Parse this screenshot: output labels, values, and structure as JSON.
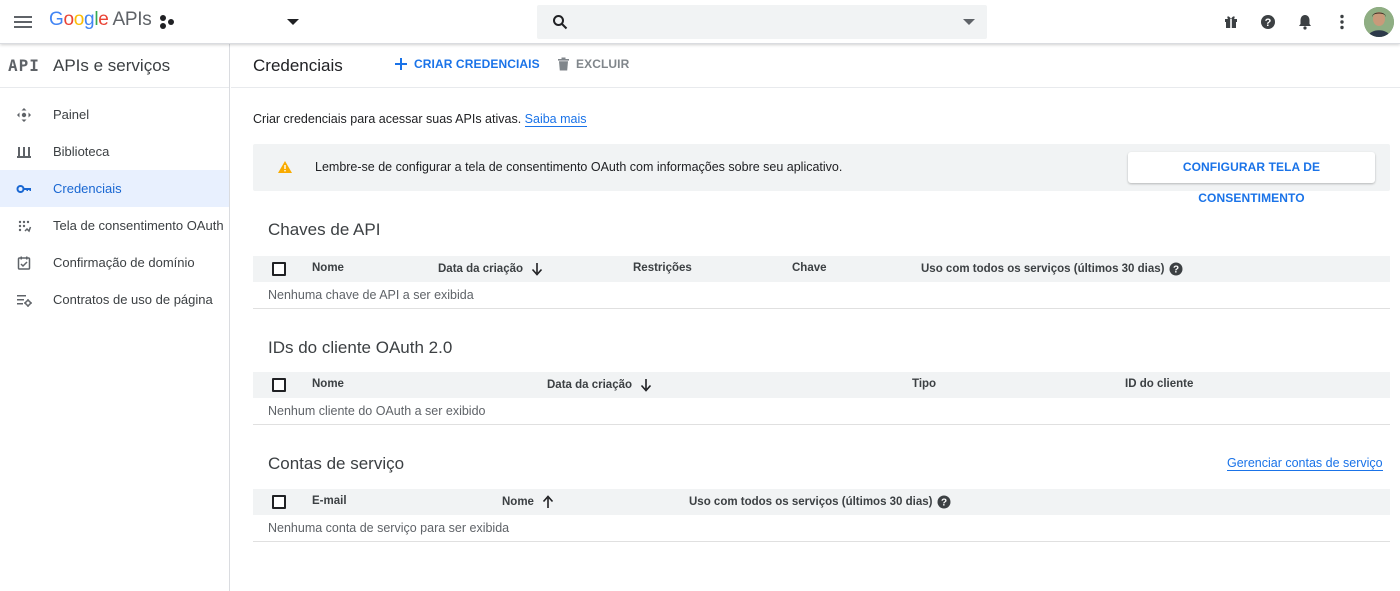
{
  "topbar": {
    "logo_letters": [
      "G",
      "o",
      "o",
      "g",
      "l",
      "e"
    ],
    "logo_suffix": "APIs",
    "search_placeholder": "",
    "icons": [
      "menu-icon",
      "project-icon",
      "dropdown-caret-icon",
      "search-icon",
      "gift-icon",
      "help-icon",
      "notifications-icon",
      "more-vert-icon",
      "avatar"
    ]
  },
  "sidebar": {
    "logo": "API",
    "title": "APIs e serviços",
    "items": [
      {
        "label": "Painel",
        "icon": "dashboard-icon",
        "active": false
      },
      {
        "label": "Biblioteca",
        "icon": "library-icon",
        "active": false
      },
      {
        "label": "Credenciais",
        "icon": "key-icon",
        "active": true
      },
      {
        "label": "Tela de consentimento OAuth",
        "icon": "consent-icon",
        "active": false
      },
      {
        "label": "Confirmação de domínio",
        "icon": "domain-check-icon",
        "active": false
      },
      {
        "label": "Contratos de uso de página",
        "icon": "page-settings-icon",
        "active": false
      }
    ]
  },
  "main": {
    "title": "Credenciais",
    "create_label": "CRIAR CREDENCIAIS",
    "delete_label": "EXCLUIR",
    "intro_text": "Criar credenciais para acessar suas APIs ativas.",
    "intro_link": "Saiba mais",
    "banner": {
      "message": "Lembre-se de configurar a tela de consentimento OAuth com informações sobre seu aplicativo.",
      "button": "CONFIGURAR TELA DE CONSENTIMENTO"
    },
    "api_keys": {
      "title": "Chaves de API",
      "columns": [
        "Nome",
        "Data da criação",
        "Restrições",
        "Chave",
        "Uso com todos os serviços (últimos 30 dias)"
      ],
      "empty": "Nenhuma chave de API a ser exibida"
    },
    "oauth": {
      "title": "IDs do cliente OAuth 2.0",
      "columns": [
        "Nome",
        "Data da criação",
        "Tipo",
        "ID do cliente"
      ],
      "empty": "Nenhum cliente do OAuth a ser exibido"
    },
    "service_accounts": {
      "title": "Contas de serviço",
      "manage_link": "Gerenciar contas de serviço",
      "columns": [
        "E-mail",
        "Nome",
        "Uso com todos os serviços (últimos 30 dias)"
      ],
      "empty": "Nenhuma conta de serviço para ser exibida"
    }
  },
  "colors": {
    "accent": "#1a73e8",
    "active_bg": "#e8f0fe",
    "warning": "#f9ab00",
    "header_row": "#f1f3f4"
  }
}
